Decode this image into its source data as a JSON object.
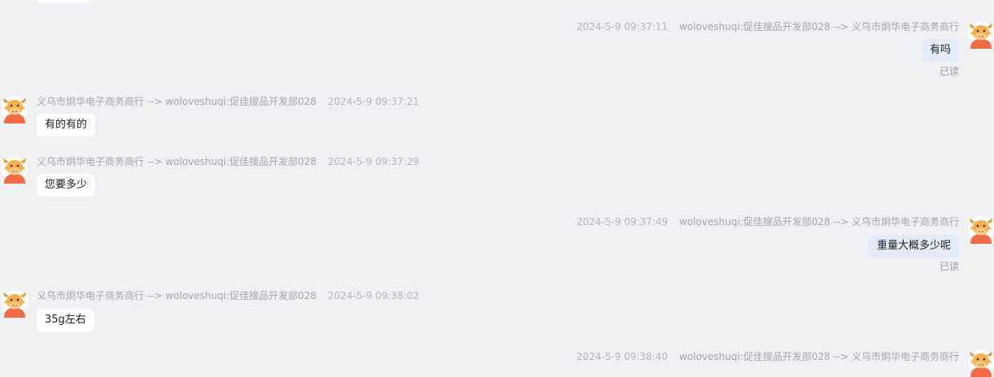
{
  "messages": [
    {
      "dir": "out",
      "time": "2024-5-9 09:37:11",
      "route": "woloveshuqi:促佳搜品开发部028 --> 义乌市炯华电子商务商行",
      "text": "有吗",
      "status": "已读"
    },
    {
      "dir": "in",
      "time": "2024-5-9 09:37:21",
      "route": "义乌市炯华电子商务商行 --> woloveshuqi:促佳搜品开发部028",
      "text": "有的有的"
    },
    {
      "dir": "in",
      "time": "2024-5-9 09:37:29",
      "route": "义乌市炯华电子商务商行 --> woloveshuqi:促佳搜品开发部028",
      "text": "您要多少"
    },
    {
      "dir": "out",
      "time": "2024-5-9 09:37:49",
      "route": "woloveshuqi:促佳搜品开发部028 --> 义乌市炯华电子商务商行",
      "text": "重量大概多少呢",
      "status": "已读"
    },
    {
      "dir": "in",
      "time": "2024-5-9 09:38:02",
      "route": "义乌市炯华电子商务商行 --> woloveshuqi:促佳搜品开发部028",
      "text": "35g左右"
    },
    {
      "dir": "out",
      "time": "2024-5-9 09:38:40",
      "route": "woloveshuqi:促佳搜品开发部028 --> 义乌市炯华电子商务商行"
    }
  ],
  "colors": {
    "background": "#f0f1f5",
    "incoming_bubble": "#ffffff",
    "outgoing_bubble": "#e4ebfb",
    "meta_text": "#a3a6ad"
  },
  "icons": {
    "avatar": "cartoon-cow-avatar"
  }
}
